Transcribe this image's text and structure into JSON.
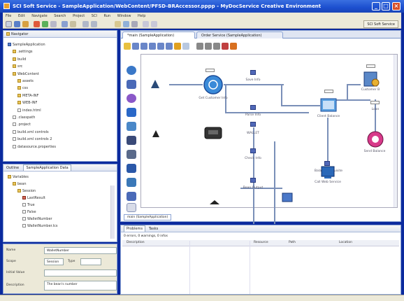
{
  "window": {
    "title": "SCI Soft Service - SampleApplication/WebContent/PFSD-BRAccessor.pppp - MyDocService Creative Environment",
    "buttons": [
      "_",
      "□",
      "×"
    ]
  },
  "menubar": [
    "File",
    "Edit",
    "Navigate",
    "Search",
    "Project",
    "SCI",
    "Run",
    "Window",
    "Help"
  ],
  "toolbar": {
    "perspective_label": "SCI Soft Service"
  },
  "navigator": {
    "tab_label": "Navigator",
    "items": [
      {
        "label": "SampleApplication",
        "icon": "project"
      },
      {
        "label": ".settings",
        "icon": "folder"
      },
      {
        "label": "build",
        "icon": "folder"
      },
      {
        "label": "src",
        "icon": "folder"
      },
      {
        "label": "WebContent",
        "icon": "folder"
      },
      {
        "label": "assets",
        "icon": "folder"
      },
      {
        "label": "css",
        "icon": "folder"
      },
      {
        "label": "META-INF",
        "icon": "folder"
      },
      {
        "label": "WEB-INF",
        "icon": "folder"
      },
      {
        "label": "index.html",
        "icon": "file"
      },
      {
        "label": ".classpath",
        "icon": "file"
      },
      {
        "label": ".project",
        "icon": "file"
      },
      {
        "label": "build.xml controls",
        "icon": "file"
      },
      {
        "label": "build.xml controls 2",
        "icon": "file"
      },
      {
        "label": "datasource.properties",
        "icon": "file"
      }
    ]
  },
  "outline": {
    "tabs": [
      "Outline",
      "SampleApplication Data"
    ],
    "items": [
      {
        "label": "Variables",
        "icon": "folder"
      },
      {
        "label": "bean",
        "icon": "folder"
      },
      {
        "label": "Session",
        "icon": "folder"
      },
      {
        "label": "LastResult",
        "icon": "jfile"
      },
      {
        "label": "True",
        "icon": "file"
      },
      {
        "label": "False",
        "icon": "file"
      },
      {
        "label": "WalletNumber",
        "icon": "file"
      },
      {
        "label": "WalletNumber.lcs",
        "icon": "file"
      }
    ]
  },
  "properties": {
    "rows": [
      {
        "label": "Name",
        "value": "WalletNumber"
      },
      {
        "label": "Scope",
        "value": "Session"
      },
      {
        "label": "Initial Value",
        "value": ""
      },
      {
        "label": "Description",
        "value": "The bean's number"
      }
    ],
    "scope_type_label": "Type"
  },
  "editor": {
    "tabs": [
      "*main (SampleApplication)",
      "Order Service (SampleApplication)"
    ],
    "bottom_tab": "main (SampleApplication)",
    "nodes": {
      "get_customer": "Get Customer Info",
      "save_info": "Save Info",
      "parse_info": "Parse Info",
      "client_balance": "Client Balance",
      "customer": "Customer B",
      "loan": "Loan",
      "balance_requisite": "Balance Requisite",
      "send_balance": "Send Balance",
      "call_web_service": "Call Web Service",
      "wallet": "WALLET",
      "check_info": "Check Info",
      "bean_output": "Bean Output"
    }
  },
  "problems": {
    "tabs": [
      "Problems",
      "Tasks"
    ],
    "summary": "0 errors, 0 warnings, 0 infos",
    "columns": [
      "Description",
      "Resource",
      "Path",
      "Location"
    ]
  },
  "colors": {
    "titlebar": "#1c4fcf",
    "chrome": "#ece9d8",
    "panel_border": "#8ca4d4",
    "connector": "#7a8fb8"
  }
}
